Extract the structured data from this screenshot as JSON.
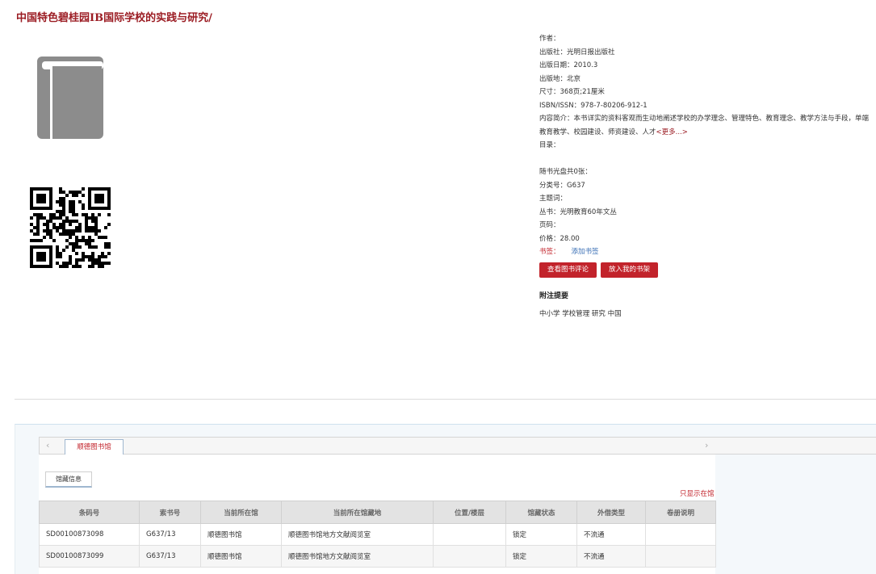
{
  "book": {
    "title": "中国特色碧桂园IB国际学校的实践与研究/"
  },
  "info": {
    "author": "作者：",
    "publisher": "出版社：光明日报出版社",
    "pub_date": "出版日期：2010.3",
    "pub_place": "出版地：北京",
    "size": "尺寸：368页;21厘米",
    "isbn": "ISBN/ISSN：978-7-80206-912-1",
    "summary": "内容简介：本书详实的资料客观而生动地阐述学校的办学理念、管理特色、教育理念、教学方法与手段，单端教育教学、校园建设、师资建设、人才",
    "more": "<更多...>",
    "toc": "目录：",
    "cd": "随书光盘共0张：",
    "class_no": "分类号：G637",
    "subject": "主题词：",
    "series": "丛书：光明教育60年文丛",
    "pages": "页码：",
    "price": "价格：28.00",
    "shelf_label": "书签：",
    "add_shelf": "添加书签"
  },
  "buttons": {
    "review": "查看图书评论",
    "add_to_shelf": "放入我的书架"
  },
  "notes": {
    "title": "附注提要",
    "body": "中小学 学校管理 研究 中国"
  },
  "library_tab": {
    "prev_arrow": "‹",
    "next_arrow": "›",
    "label": "顺德图书馆"
  },
  "holding_tab": "馆藏信息",
  "only_in_library": "只显示在馆",
  "table": {
    "headers": [
      "条码号",
      "索书号",
      "当前所在馆",
      "当前所在馆藏地",
      "位置/楼层",
      "馆藏状态",
      "外借类型",
      "卷册说明"
    ],
    "rows": [
      [
        "SD00100873098",
        "G637/13",
        "顺德图书馆",
        "顺德图书馆地方文献阅览室",
        "",
        "锁定",
        "不流通",
        ""
      ],
      [
        "SD00100873099",
        "G637/13",
        "顺德图书馆",
        "顺德图书馆地方文献阅览室",
        "",
        "锁定",
        "不流通",
        ""
      ]
    ]
  },
  "colors": {
    "accent": "#c2232b",
    "title": "#9b1c23",
    "link": "#3a6fb5",
    "icon_gray": "#8c8c8c"
  }
}
